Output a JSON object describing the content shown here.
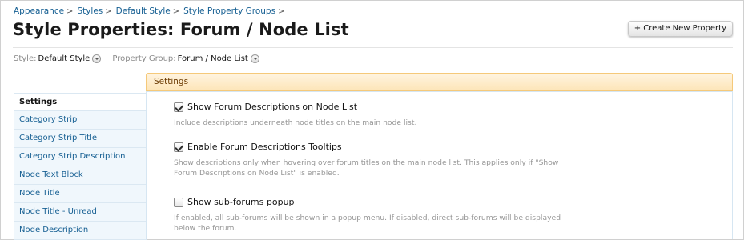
{
  "breadcrumb": {
    "items": [
      "Appearance",
      "Styles",
      "Default Style",
      "Style Property Groups"
    ],
    "separator": ">"
  },
  "page_title": "Style Properties: Forum / Node List",
  "create_button": "+ Create New Property",
  "filters": {
    "style_label": "Style:",
    "style_value": "Default Style",
    "group_label": "Property Group:",
    "group_value": "Forum / Node List"
  },
  "sidebar": {
    "items": [
      {
        "label": "Settings",
        "active": true
      },
      {
        "label": "Category Strip"
      },
      {
        "label": "Category Strip Title"
      },
      {
        "label": "Category Strip Description"
      },
      {
        "label": "Node Text Block"
      },
      {
        "label": "Node Title"
      },
      {
        "label": "Node Title - Unread"
      },
      {
        "label": "Node Description"
      }
    ]
  },
  "panel": {
    "header": "Settings",
    "options": [
      {
        "label": "Show Forum Descriptions on Node List",
        "checked": true,
        "hint": "Include descriptions underneath node titles on the main node list."
      },
      {
        "label": "Enable Forum Descriptions Tooltips",
        "checked": true,
        "hint_line1": "Show descriptions only when hovering over forum titles on the main node list. This applies only if \"Show",
        "hint_line2": "Forum Descriptions on Node List\" is enabled."
      },
      {
        "label": "Show sub-forums popup",
        "checked": false,
        "hint_line1": "If enabled, all sub-forums will be shown in a popup menu. If disabled, direct sub-forums will be displayed",
        "hint_line2": "below the forum."
      }
    ]
  },
  "colors": {
    "link": "#176093",
    "header_bg": "#fde5b8",
    "header_border": "#f5c97a",
    "sidebar_bg": "#f0f7fc"
  }
}
